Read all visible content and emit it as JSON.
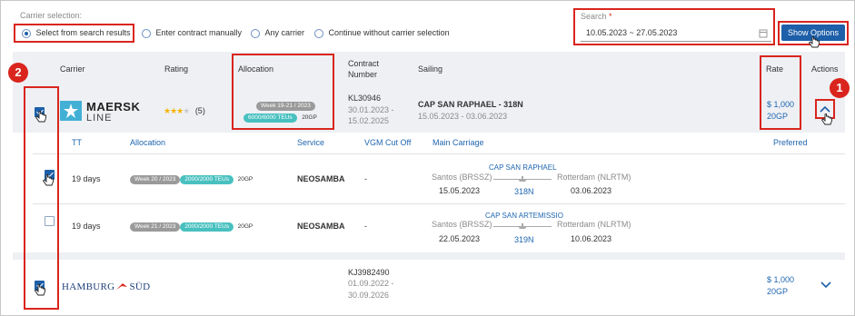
{
  "carrier_selection": {
    "label": "Carrier selection:",
    "options": [
      {
        "label": "Select from search results",
        "selected": true
      },
      {
        "label": "Enter contract manually",
        "selected": false
      },
      {
        "label": "Any carrier",
        "selected": false
      },
      {
        "label": "Continue without carrier selection",
        "selected": false
      }
    ]
  },
  "search": {
    "label": "Search",
    "required_mark": "*",
    "value": "10.05.2023 ~ 27.05.2023",
    "button": "Show Options"
  },
  "table_header": {
    "carrier": "Carrier",
    "rating": "Rating",
    "allocation": "Allocation",
    "contract_line1": "Contract",
    "contract_line2": "Number",
    "sailing": "Sailing",
    "rate": "Rate",
    "actions": "Actions"
  },
  "rows": [
    {
      "carrier_name": "MAERSK",
      "carrier_sub": "LINE",
      "rating_count": "(5)",
      "stars": 3.5,
      "allocation_week": "Week 19-21 / 2023",
      "allocation_teu": "6000/6000 TEUs",
      "allocation_unit": "20GP",
      "contract": "KL30946",
      "contract_from": "30.01.2023 -",
      "contract_to": "15.02.2025",
      "sailing_name": "CAP SAN RAPHAEL - 318N",
      "sailing_dates": "15.05.2023 - 03.06.2023",
      "rate": "$ 1,000",
      "rate_unit": "20GP"
    },
    {
      "carrier_name": "HAMBURG",
      "carrier_sub": "SÜD",
      "contract": "KJ3982490",
      "contract_from": "01.09.2022 -",
      "contract_to": "30.09.2026",
      "rate": "$ 1,000",
      "rate_unit": "20GP"
    }
  ],
  "sub_header": {
    "tt": "TT",
    "allocation": "Allocation",
    "service": "Service",
    "vgm": "VGM Cut Off",
    "main_carriage": "Main Carriage",
    "preferred": "Preferred"
  },
  "sub_rows": [
    {
      "tt": "19 days",
      "week": "Week 20 / 2023",
      "teu": "2000/2000 TEUs",
      "unit": "20GP",
      "service": "NEOSAMBA",
      "vgm": "-",
      "vessel": "CAP SAN RAPHAEL",
      "voyage": "318N",
      "from_port": "Santos (BRSSZ)",
      "from_date": "15.05.2023",
      "to_port": "Rotterdam (NLRTM)",
      "to_date": "03.06.2023"
    },
    {
      "tt": "19 days",
      "week": "Week 21 / 2023",
      "teu": "2000/2000 TEUs",
      "unit": "20GP",
      "service": "NEOSAMBA",
      "vgm": "-",
      "vessel": "CAP SAN ARTEMISSIO",
      "voyage": "319N",
      "from_port": "Santos (BRSSZ)",
      "from_date": "22.05.2023",
      "to_port": "Rotterdam (NLRTM)",
      "to_date": "10.06.2023"
    }
  ],
  "callouts": {
    "one": "1",
    "two": "2"
  },
  "colors": {
    "accent": "#1d5fa8",
    "highlight": "#d9251d",
    "teal": "#49c0c0"
  }
}
